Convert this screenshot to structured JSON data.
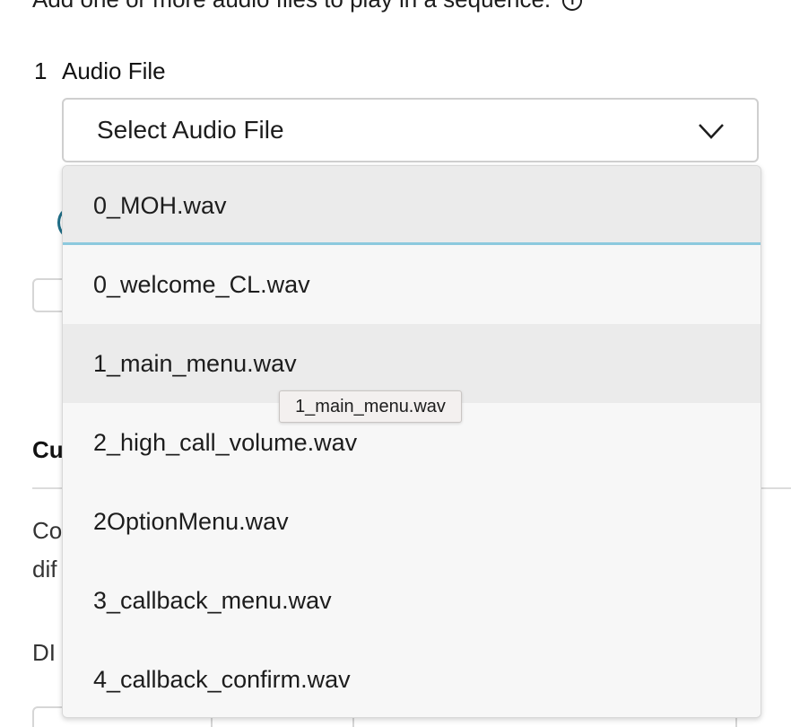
{
  "intro": {
    "text": "Add one or more audio files to play in a sequence."
  },
  "audio_row": {
    "number": "1",
    "label": "Audio File"
  },
  "select": {
    "value": "Select Audio File",
    "chevron_icon": "chevron-down-icon"
  },
  "background": {
    "heading": "Cu",
    "desc_line1": "Co",
    "desc_line2": "dif",
    "dtmf_label": "DI"
  },
  "dropdown": {
    "options": [
      "0_MOH.wav",
      "0_welcome_CL.wav",
      "1_main_menu.wav",
      "2_high_call_volume.wav",
      "2OptionMenu.wav",
      "3_callback_menu.wav",
      "4_callback_confirm.wav"
    ],
    "selected_index": 0,
    "hovered_index": 2
  },
  "tooltip": {
    "text": "1_main_menu.wav"
  },
  "colors": {
    "selected_underline": "#8cc9de",
    "radio_accent": "#1f6e88"
  }
}
